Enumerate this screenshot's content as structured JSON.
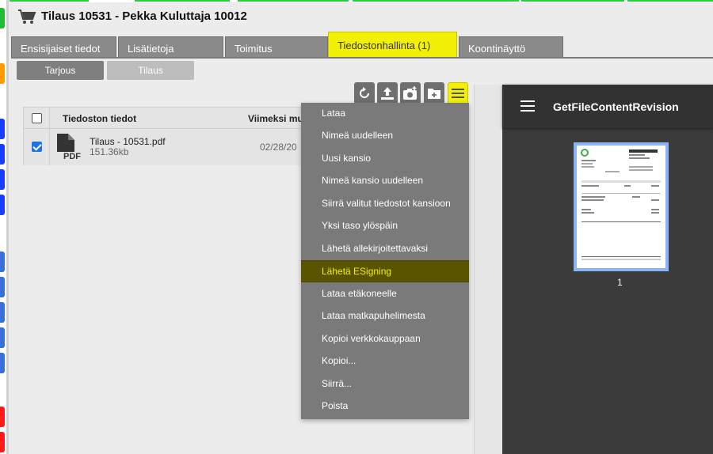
{
  "header": {
    "title": "Tilaus 10531 - Pekka Kuluttaja 10012"
  },
  "tabs": [
    {
      "label": "Ensisijaiset tiedot"
    },
    {
      "label": "Lisätietoja"
    },
    {
      "label": "Toimitus"
    },
    {
      "label": "Tiedostonhallinta (1)"
    },
    {
      "label": "Koontinäyttö"
    }
  ],
  "subtabs": [
    {
      "label": "Tarjous"
    },
    {
      "label": "Tilaus"
    }
  ],
  "toolbar": {
    "icons": [
      "refresh-icon",
      "upload-icon",
      "camera-add-icon",
      "new-folder-icon",
      "menu-icon"
    ]
  },
  "table": {
    "headers": {
      "file_info": "Tiedoston tiedot",
      "modified": "Viimeksi mu"
    },
    "rows": [
      {
        "name": "Tilaus - 10531.pdf",
        "size": "151.36kb",
        "date": "02/28/20",
        "checked": true,
        "icon": "pdf-icon"
      }
    ]
  },
  "menu": {
    "items": [
      {
        "label": "Lataa"
      },
      {
        "label": "Nimeä uudelleen"
      },
      {
        "label": "Uusi kansio"
      },
      {
        "label": "Nimeä kansio uudelleen"
      },
      {
        "label": "Siirrä valitut tiedostot kansioon"
      },
      {
        "label": "Yksi taso ylöspäin"
      },
      {
        "label": "Lähetä allekirjoitettavaksi"
      },
      {
        "label": "Lähetä ESigning"
      },
      {
        "label": "Lataa etäkoneelle"
      },
      {
        "label": "Lataa matkapuhelimesta"
      },
      {
        "label": "Kopioi verkkokauppaan"
      },
      {
        "label": "Kopioi..."
      },
      {
        "label": "Siirrä..."
      },
      {
        "label": "Poista"
      }
    ],
    "highlighted": "Lähetä ESigning"
  },
  "viewer": {
    "title": "GetFileContentRevision",
    "page_number": "1"
  },
  "colors": {
    "accent": "#f2f007",
    "tab_bg": "#8a8a8a",
    "viewer_bg": "#3b3b3b",
    "highlight_bg": "#5a5400"
  }
}
